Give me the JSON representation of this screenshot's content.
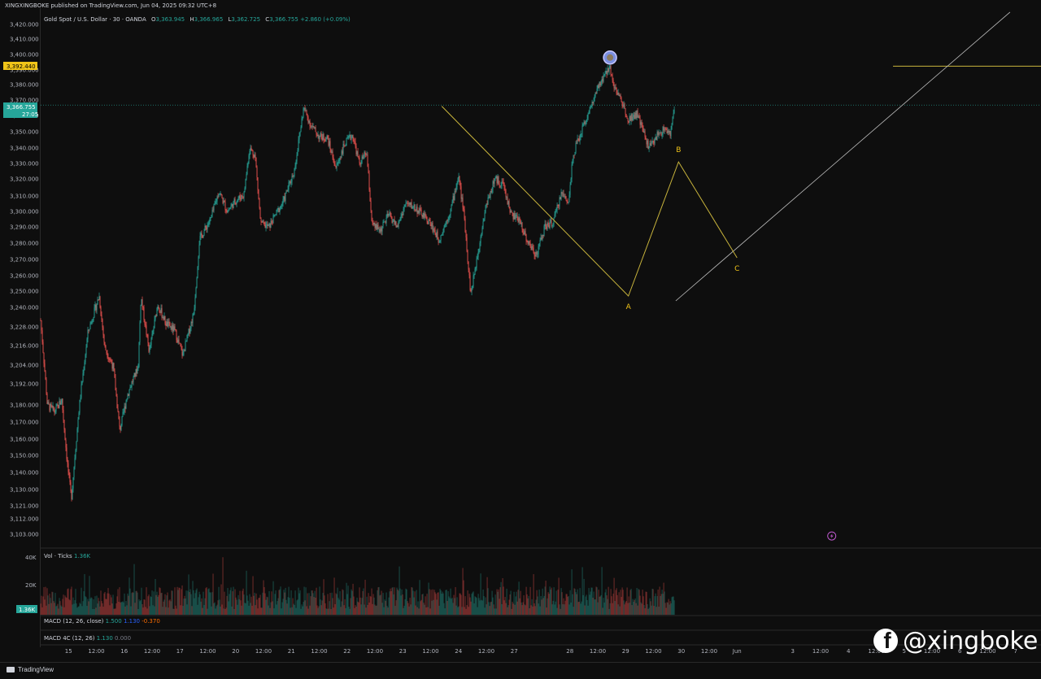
{
  "header": {
    "published_by": "XINGXINGBOKE published on TradingView.com, Jun 04, 2025 09:32 UTC+8"
  },
  "legend": {
    "symbol": "Gold Spot / U.S. Dollar · 30 · OANDA",
    "open_label": "O",
    "open": "3,363.945",
    "high_label": "H",
    "high": "3,366.965",
    "low_label": "L",
    "low": "3,362.725",
    "close_label": "C",
    "close": "3,366.755",
    "change": "+2.860 (+0.09%)"
  },
  "price_tags": {
    "resistance": "3,392.440",
    "last_price": "3,366.755",
    "countdown": "27:05",
    "volume_last": "1.36K"
  },
  "volume_pane": {
    "label": "Vol · Ticks",
    "value": "1.36K",
    "ticks": [
      "40K",
      "20K"
    ]
  },
  "macd_pane": {
    "label": "MACD (12, 26, close)",
    "v1": "1.500",
    "v2": "1.130",
    "v3": "-0.370"
  },
  "macd4c_pane": {
    "label": "MACD 4C (12, 26)",
    "v1": "1.130",
    "v2": "0.000"
  },
  "footer": {
    "brand": "TradingView"
  },
  "watermark": {
    "handle": "@xingboke",
    "icon": "facebook-icon"
  },
  "colors": {
    "up": "#26a69a",
    "down": "#ef5350",
    "wave": "#c8b43c",
    "trendline": "#c0c0c0",
    "resistance": "#c8b43c",
    "marker": "#7b8fe0"
  },
  "chart_data": {
    "type": "candlestick",
    "title": "Gold Spot / U.S. Dollar · 30 · OANDA",
    "y_ticks": [
      {
        "label": "3,420.000",
        "value": 3420
      },
      {
        "label": "3,410.000",
        "value": 3410
      },
      {
        "label": "3,400.000",
        "value": 3400
      },
      {
        "label": "3,390.000",
        "value": 3390
      },
      {
        "label": "3,380.000",
        "value": 3380
      },
      {
        "label": "3,370.000",
        "value": 3370
      },
      {
        "label": "3,360.000",
        "value": 3360
      },
      {
        "label": "3,350.000",
        "value": 3350
      },
      {
        "label": "3,340.000",
        "value": 3340
      },
      {
        "label": "3,330.000",
        "value": 3330
      },
      {
        "label": "3,320.000",
        "value": 3320
      },
      {
        "label": "3,310.000",
        "value": 3310
      },
      {
        "label": "3,300.000",
        "value": 3300
      },
      {
        "label": "3,290.000",
        "value": 3290
      },
      {
        "label": "3,280.000",
        "value": 3280
      },
      {
        "label": "3,270.000",
        "value": 3270
      },
      {
        "label": "3,260.000",
        "value": 3260
      },
      {
        "label": "3,250.000",
        "value": 3250
      },
      {
        "label": "3,240.000",
        "value": 3240
      },
      {
        "label": "3,228.000",
        "value": 3228
      },
      {
        "label": "3,216.000",
        "value": 3216
      },
      {
        "label": "3,204.000",
        "value": 3204
      },
      {
        "label": "3,192.000",
        "value": 3192
      },
      {
        "label": "3,180.000",
        "value": 3180
      },
      {
        "label": "3,170.000",
        "value": 3170
      },
      {
        "label": "3,160.000",
        "value": 3160
      },
      {
        "label": "3,150.000",
        "value": 3150
      },
      {
        "label": "3,140.000",
        "value": 3140
      },
      {
        "label": "3,130.000",
        "value": 3130
      },
      {
        "label": "3,121.000",
        "value": 3121
      },
      {
        "label": "3,112.000",
        "value": 3112
      },
      {
        "label": "3,103.000",
        "value": 3103
      }
    ],
    "x_ticks": [
      {
        "label": "15",
        "t": 0.5
      },
      {
        "label": "12:00",
        "t": 1.0
      },
      {
        "label": "16",
        "t": 1.5
      },
      {
        "label": "12:00",
        "t": 2.0
      },
      {
        "label": "17",
        "t": 2.5
      },
      {
        "label": "12:00",
        "t": 3.0
      },
      {
        "label": "20",
        "t": 3.5
      },
      {
        "label": "12:00",
        "t": 4.0
      },
      {
        "label": "21",
        "t": 4.5
      },
      {
        "label": "12:00",
        "t": 5.0
      },
      {
        "label": "22",
        "t": 5.5
      },
      {
        "label": "12:00",
        "t": 6.0
      },
      {
        "label": "23",
        "t": 6.5
      },
      {
        "label": "12:00",
        "t": 7.0
      },
      {
        "label": "24",
        "t": 7.5
      },
      {
        "label": "12:00",
        "t": 8.0
      },
      {
        "label": "27",
        "t": 8.5
      },
      {
        "label": "28",
        "t": 9.5
      },
      {
        "label": "12:00",
        "t": 10.0
      },
      {
        "label": "29",
        "t": 10.5
      },
      {
        "label": "12:00",
        "t": 11.0
      },
      {
        "label": "30",
        "t": 11.5
      },
      {
        "label": "12:00",
        "t": 12.0
      },
      {
        "label": "Jun",
        "t": 12.5
      },
      {
        "label": "3",
        "t": 13.5
      },
      {
        "label": "12:00",
        "t": 14.0
      },
      {
        "label": "4",
        "t": 14.5
      },
      {
        "label": "12:00",
        "t": 15.0
      },
      {
        "label": "5",
        "t": 15.5
      },
      {
        "label": "12:00",
        "t": 16.0
      },
      {
        "label": "6",
        "t": 16.5
      },
      {
        "label": "12:00",
        "t": 17.0
      },
      {
        "label": "7",
        "t": 17.5
      }
    ],
    "price_path": [
      [
        0.0,
        3232
      ],
      [
        0.12,
        3180
      ],
      [
        0.25,
        3176
      ],
      [
        0.38,
        3183
      ],
      [
        0.48,
        3145
      ],
      [
        0.55,
        3125
      ],
      [
        0.68,
        3175
      ],
      [
        0.85,
        3225
      ],
      [
        1.05,
        3247
      ],
      [
        1.15,
        3215
      ],
      [
        1.3,
        3203
      ],
      [
        1.42,
        3165
      ],
      [
        1.55,
        3185
      ],
      [
        1.75,
        3203
      ],
      [
        1.8,
        3247
      ],
      [
        1.95,
        3212
      ],
      [
        2.1,
        3242
      ],
      [
        2.25,
        3230
      ],
      [
        2.4,
        3226
      ],
      [
        2.55,
        3210
      ],
      [
        2.75,
        3237
      ],
      [
        2.85,
        3282
      ],
      [
        3.05,
        3295
      ],
      [
        3.2,
        3313
      ],
      [
        3.35,
        3300
      ],
      [
        3.5,
        3307
      ],
      [
        3.65,
        3311
      ],
      [
        3.75,
        3340
      ],
      [
        3.85,
        3335
      ],
      [
        3.95,
        3292
      ],
      [
        4.1,
        3290
      ],
      [
        4.2,
        3297
      ],
      [
        4.35,
        3306
      ],
      [
        4.55,
        3325
      ],
      [
        4.72,
        3365
      ],
      [
        4.85,
        3354
      ],
      [
        5.0,
        3347
      ],
      [
        5.15,
        3346
      ],
      [
        5.3,
        3327
      ],
      [
        5.45,
        3342
      ],
      [
        5.6,
        3348
      ],
      [
        5.72,
        3330
      ],
      [
        5.85,
        3337
      ],
      [
        5.95,
        3291
      ],
      [
        6.1,
        3288
      ],
      [
        6.25,
        3298
      ],
      [
        6.4,
        3290
      ],
      [
        6.55,
        3305
      ],
      [
        6.7,
        3303
      ],
      [
        6.85,
        3298
      ],
      [
        7.0,
        3292
      ],
      [
        7.15,
        3282
      ],
      [
        7.35,
        3300
      ],
      [
        7.5,
        3322
      ],
      [
        7.6,
        3298
      ],
      [
        7.72,
        3248
      ],
      [
        7.85,
        3275
      ],
      [
        8.0,
        3305
      ],
      [
        8.15,
        3320
      ],
      [
        8.3,
        3317
      ],
      [
        8.45,
        3298
      ],
      [
        8.6,
        3294
      ],
      [
        8.75,
        3280
      ],
      [
        8.9,
        3273
      ],
      [
        9.05,
        3290
      ],
      [
        9.2,
        3293
      ],
      [
        9.35,
        3312
      ],
      [
        9.48,
        3306
      ],
      [
        9.55,
        3335
      ],
      [
        9.7,
        3350
      ],
      [
        9.85,
        3363
      ],
      [
        10.0,
        3377
      ],
      [
        10.12,
        3386
      ],
      [
        10.22,
        3392
      ],
      [
        10.3,
        3378
      ],
      [
        10.42,
        3370
      ],
      [
        10.55,
        3358
      ],
      [
        10.7,
        3361
      ],
      [
        10.82,
        3350
      ],
      [
        10.92,
        3340
      ],
      [
        11.05,
        3347
      ],
      [
        11.2,
        3352
      ],
      [
        11.3,
        3348
      ],
      [
        11.38,
        3366
      ]
    ],
    "wave": {
      "points": [
        {
          "label": "",
          "t": 7.2,
          "value": 3366
        },
        {
          "label": "A",
          "t": 10.55,
          "value": 3247
        },
        {
          "label": "B",
          "t": 11.45,
          "value": 3331
        },
        {
          "label": "C",
          "t": 12.5,
          "value": 3271
        }
      ]
    },
    "trendline": {
      "t1": 11.4,
      "v1": 3244,
      "t2": 17.4,
      "v2": 3428
    },
    "resistance": {
      "value": 3392.44,
      "t_start": 15.3
    },
    "last_price": 3366.755,
    "marker": {
      "t": 10.22,
      "value": 3398
    },
    "lightning_marker": {
      "t": 14.2,
      "value": 3102
    },
    "volume_ylim": [
      0,
      46000
    ]
  }
}
